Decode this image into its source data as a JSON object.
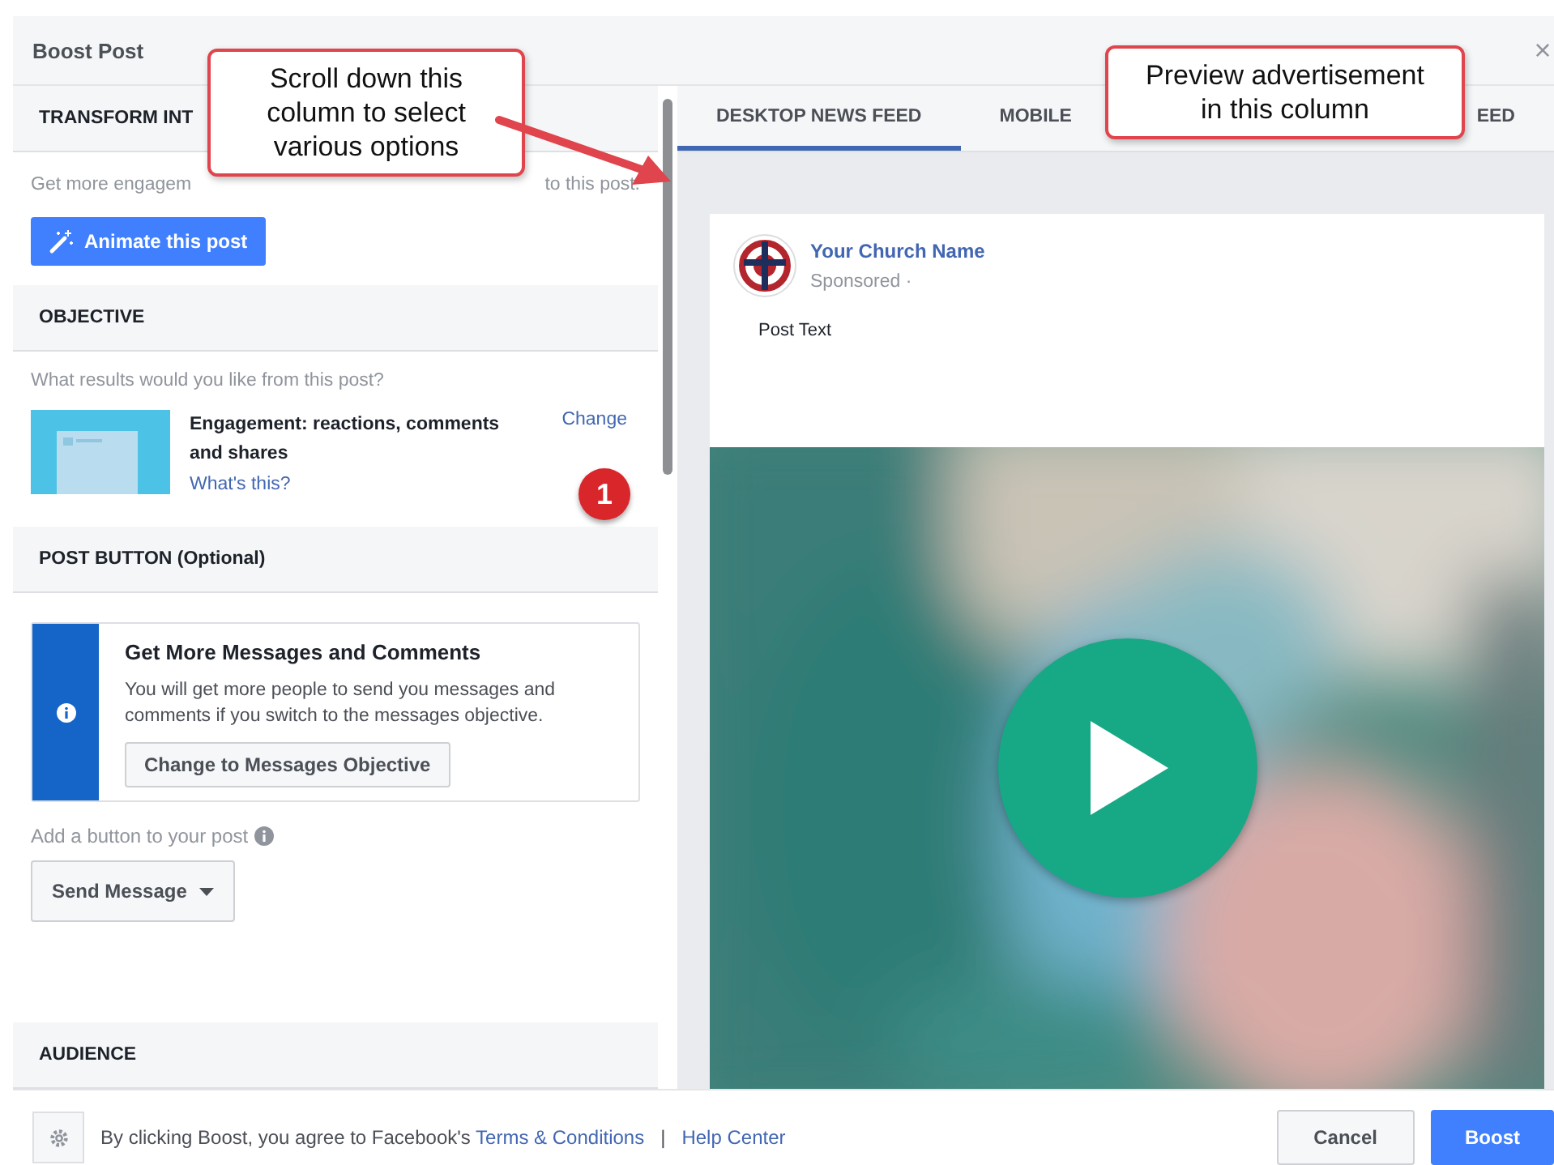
{
  "dialog": {
    "title": "Boost Post",
    "close": "×"
  },
  "transform": {
    "heading": "TRANSFORM INT",
    "text_before": "Get more engagem",
    "text_after": "to this post.",
    "button": "Animate this post"
  },
  "objective": {
    "heading": "OBJECTIVE",
    "question": "What results would you like from this post?",
    "title": "Engagement: reactions, comments and shares",
    "help_link": "What's this?",
    "change_link": "Change"
  },
  "post_button": {
    "heading": "POST BUTTON (Optional)",
    "notice": {
      "title": "Get More Messages and Comments",
      "body": "You will get more people to send you messages and comments if you switch to the messages objective.",
      "button": "Change to Messages Objective"
    },
    "label": "Add a button to your post",
    "dropdown": "Send Message"
  },
  "audience": {
    "heading": "AUDIENCE"
  },
  "preview": {
    "tabs": [
      {
        "label": "DESKTOP NEWS FEED",
        "selected": true
      },
      {
        "label": "MOBILE",
        "selected": false
      },
      {
        "label": "EED",
        "selected": false
      }
    ],
    "page_name": "Your Church Name",
    "sponsored": "Sponsored ·",
    "post_text": "Post Text"
  },
  "footer": {
    "agreement": "By clicking Boost, you agree to Facebook's",
    "terms_link": "Terms & Conditions",
    "separator": "|",
    "help_link": "Help Center"
  },
  "buttons": [
    {
      "label": "Cancel",
      "kind": "secondary"
    },
    {
      "label": "Boost",
      "kind": "primary"
    }
  ],
  "annotations": [
    {
      "lines": [
        "Scroll down this",
        "column to select",
        "various options"
      ]
    },
    {
      "lines": [
        "Preview advertisement",
        "in this column"
      ]
    }
  ],
  "step_badge": "1"
}
